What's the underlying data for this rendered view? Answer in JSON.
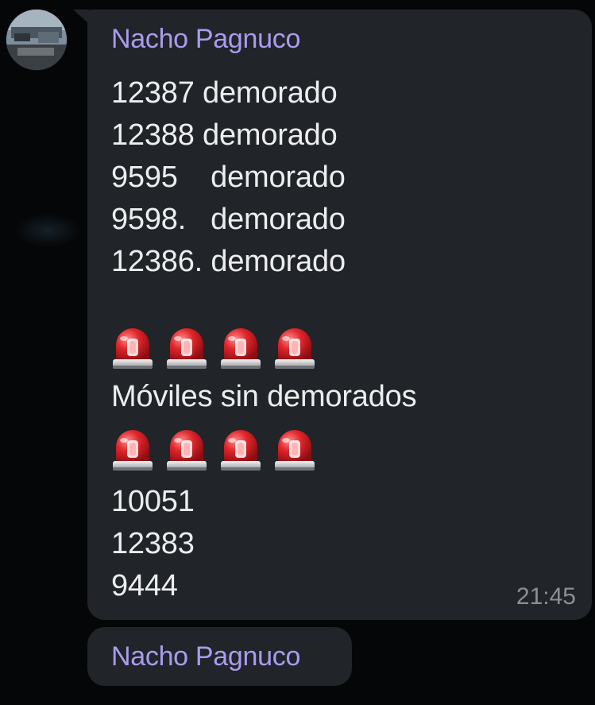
{
  "message": {
    "sender": "Nacho Pagnuco",
    "lines_top": [
      "12387 demorado",
      "12388 demorado",
      "9595    demorado",
      "9598.   demorado",
      "12386. demorado"
    ],
    "siren_icon": "police-siren-icon",
    "siren_color": "#e0262b",
    "middle_text": "Móviles sin demorados",
    "lines_bottom": [
      "10051",
      "12383",
      "9444"
    ],
    "time": "21:45"
  },
  "next_message": {
    "sender": "Nacho Pagnuco"
  },
  "colors": {
    "background": "#050607",
    "bubble": "#212428",
    "sender": "#a99bf0",
    "text": "#ecedef",
    "time": "#8c9096"
  }
}
